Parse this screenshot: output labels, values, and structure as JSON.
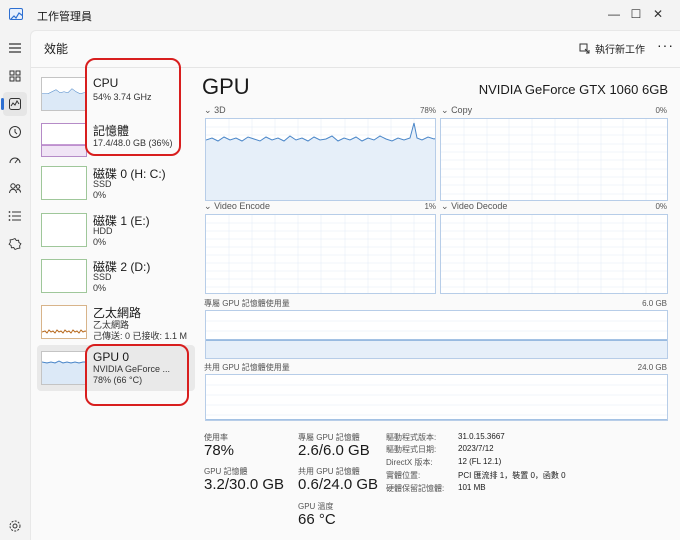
{
  "app": {
    "title": "工作管理員"
  },
  "window_controls": {
    "minimize": "—",
    "maximize": "☐",
    "close": "✕"
  },
  "nav": [
    {
      "icon": "hamburger-menu-icon"
    },
    {
      "icon": "processes-icon"
    },
    {
      "icon": "performance-icon",
      "active": true
    },
    {
      "icon": "app-history-icon"
    },
    {
      "icon": "startup-apps-icon"
    },
    {
      "icon": "users-icon"
    },
    {
      "icon": "details-icon"
    },
    {
      "icon": "services-icon"
    },
    {
      "icon": "settings-icon"
    }
  ],
  "header": {
    "title": "效能",
    "run_task": "執行新工作",
    "more": "···"
  },
  "devices": [
    {
      "name": "CPU",
      "line1": "54% 3.74 GHz",
      "line2": ""
    },
    {
      "name": "記憶體",
      "line1": "17.4/48.0 GB (36%)",
      "line2": ""
    },
    {
      "name": "磁碟 0 (H: C:)",
      "line1": "SSD",
      "line2": "0%"
    },
    {
      "name": "磁碟 1 (E:)",
      "line1": "HDD",
      "line2": "0%"
    },
    {
      "name": "磁碟 2 (D:)",
      "line1": "SSD",
      "line2": "0%"
    },
    {
      "name": "乙太網路",
      "line1": "乙太網路",
      "line2": "己傳送: 0 已接收: 1.1 M"
    },
    {
      "name": "GPU 0",
      "line1": "NVIDIA GeForce ...",
      "line2": "78% (66 °C)"
    }
  ],
  "gpu": {
    "title": "GPU",
    "model": "NVIDIA GeForce GTX 1060 6GB",
    "engines": [
      {
        "label": "3D",
        "percent": "78%"
      },
      {
        "label": "Copy",
        "percent": "0%"
      },
      {
        "label": "Video Encode",
        "percent": "1%"
      },
      {
        "label": "Video Decode",
        "percent": "0%"
      }
    ],
    "dedicated_memory": {
      "label": "專屬 GPU 記憶體使用量",
      "max": "6.0 GB"
    },
    "shared_memory": {
      "label": "共用 GPU 記憶體使用量",
      "max": "24.0 GB"
    },
    "stats": {
      "utilization": {
        "label": "使用率",
        "value": "78%"
      },
      "dedicated": {
        "label": "專屬 GPU 記憶體",
        "value": "2.6/6.0 GB"
      },
      "gpu_memory": {
        "label": "GPU 記憶體",
        "value": "3.2/30.0 GB"
      },
      "shared": {
        "label": "共用 GPU 記憶體",
        "value": "0.6/24.0 GB"
      },
      "temperature": {
        "label": "GPU 溫度",
        "value": "66 °C"
      }
    },
    "info": [
      {
        "key": "驅動程式版本:",
        "value": "31.0.15.3667"
      },
      {
        "key": "驅動程式日期:",
        "value": "2023/7/12"
      },
      {
        "key": "DirectX 版本:",
        "value": "12 (FL 12.1)"
      },
      {
        "key": "實體位置:",
        "value": "PCI 匯流排 1，裝置 0，函數 0"
      },
      {
        "key": "硬體保留記憶體:",
        "value": "101 MB"
      }
    ]
  },
  "colors": {
    "accent": "#2d6fd1",
    "gpu_graph": "#4a86c8",
    "memory_graph": "#8b3aa8",
    "network_graph": "#b86a1e",
    "annotation": "#d81e1e"
  }
}
